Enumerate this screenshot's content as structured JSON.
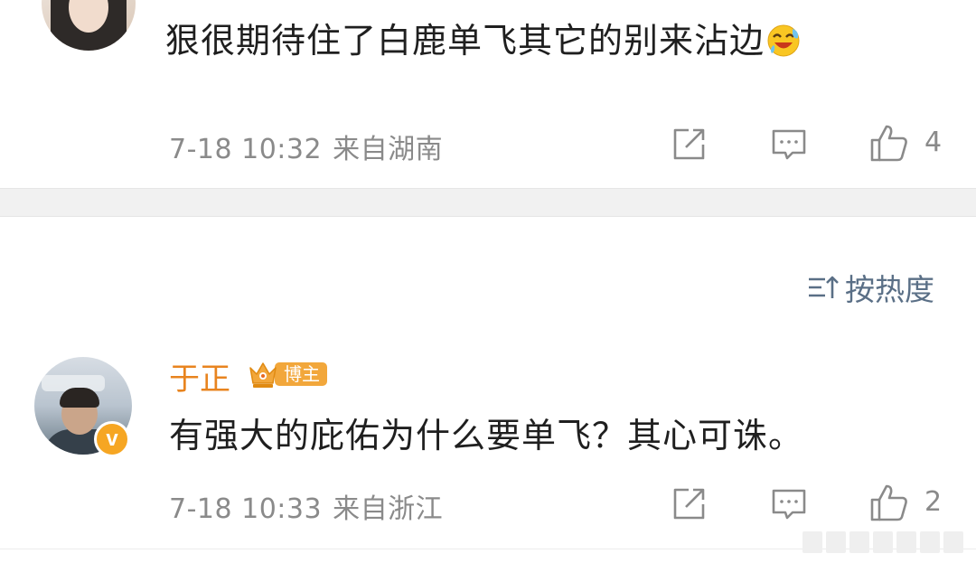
{
  "comments": [
    {
      "avatar_icon": "user-avatar",
      "text": "狠很期待住了白鹿单飞其它的别来沾边",
      "emoji_icon": "laughing-crying-emoji",
      "date": "7-18 10:32",
      "location": "来自湖南",
      "likes": "4"
    },
    {
      "avatar_icon": "user-avatar",
      "username": "于正",
      "badge_label": "博主",
      "badge_icon": "crown-icon",
      "verified_mark": "v",
      "text": "有强大的庇佑为什么要单飞？其心可诛。",
      "date": "7-18 10:33",
      "location": "来自浙江",
      "likes": "2"
    }
  ],
  "sort": {
    "label": "按热度",
    "icon": "sort-icon"
  },
  "actions": {
    "share_icon": "share-icon",
    "comment_icon": "comment-icon",
    "like_icon": "thumbs-up-icon"
  },
  "colors": {
    "username": "#e8841f",
    "badge": "#f2a73b",
    "sort_link": "#5a6f86",
    "meta": "#8a8a8a",
    "divider": "#f1f1f1"
  }
}
